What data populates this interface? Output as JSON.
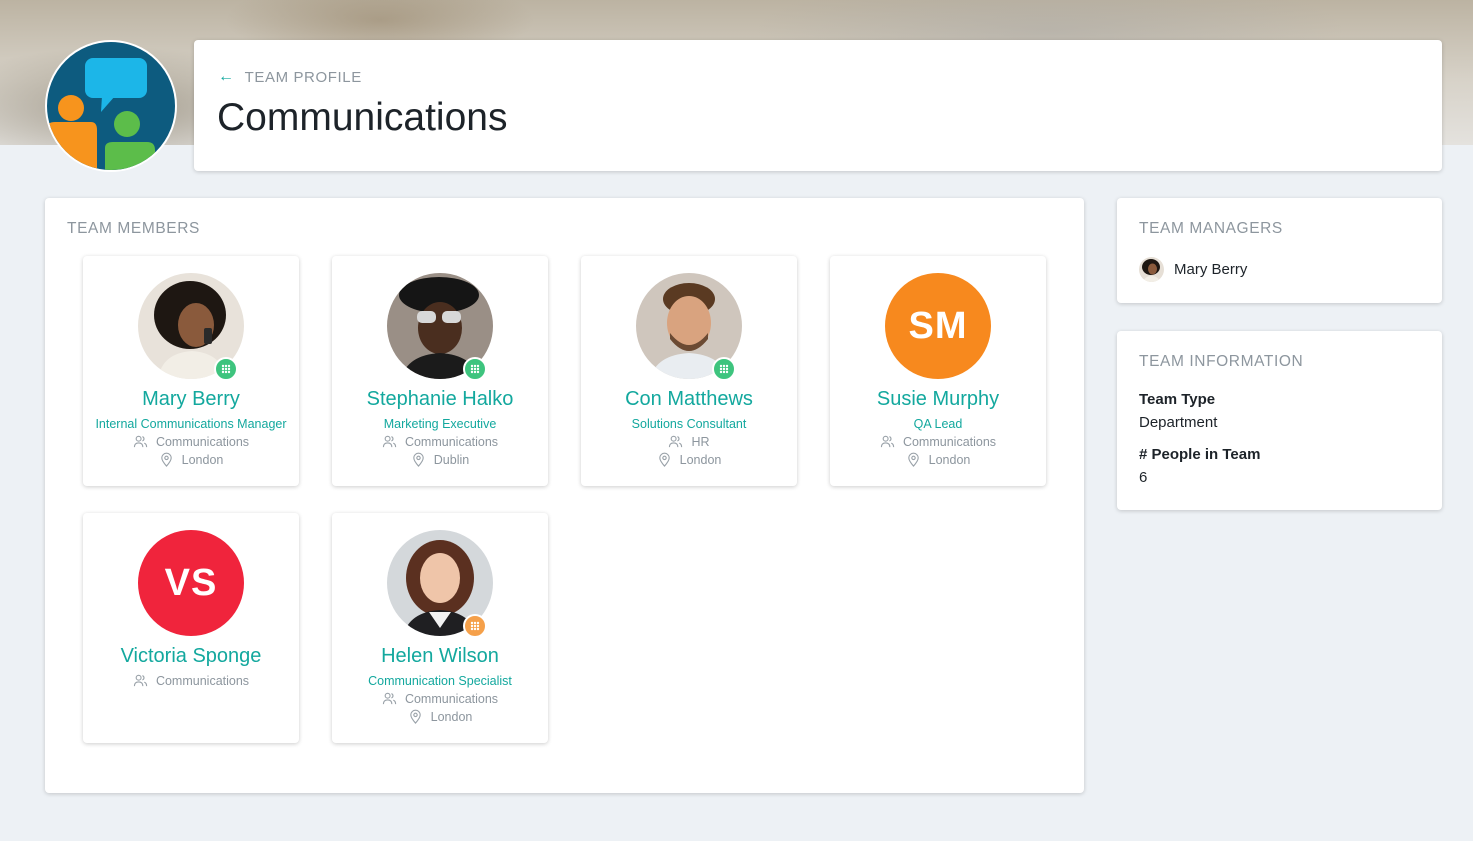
{
  "header": {
    "back_label": "TEAM PROFILE",
    "title": "Communications"
  },
  "members_section": {
    "title": "TEAM MEMBERS",
    "members": [
      {
        "name": "Mary Berry",
        "role": "Internal Communications Manager",
        "department": "Communications",
        "location": "London",
        "avatar": "photo",
        "status": "green"
      },
      {
        "name": "Stephanie Halko",
        "role": "Marketing Executive",
        "department": "Communications",
        "location": "Dublin",
        "avatar": "photo",
        "status": "green"
      },
      {
        "name": "Con Matthews",
        "role": "Solutions Consultant",
        "department": "HR",
        "location": "London",
        "avatar": "photo",
        "status": "green"
      },
      {
        "name": "Susie Murphy",
        "role": "QA Lead",
        "department": "Communications",
        "location": "London",
        "avatar": "initials",
        "initials": "SM",
        "avatar_color": "#f7891e"
      },
      {
        "name": "Victoria Sponge",
        "role": "",
        "department": "Communications",
        "location": "",
        "avatar": "initials",
        "initials": "VS",
        "avatar_color": "#f0243c"
      },
      {
        "name": "Helen Wilson",
        "role": "Communication Specialist",
        "department": "Communications",
        "location": "London",
        "avatar": "photo",
        "status": "orange"
      }
    ]
  },
  "managers": {
    "title": "TEAM MANAGERS",
    "items": [
      {
        "name": "Mary Berry"
      }
    ]
  },
  "team_info": {
    "title": "TEAM INFORMATION",
    "team_type_label": "Team Type",
    "team_type_value": "Department",
    "people_label": "# People in Team",
    "people_value": "6"
  },
  "colors": {
    "accent": "#13a89e",
    "status_green": "#3ec47e",
    "status_orange": "#f5a04a",
    "muted": "#8d969e"
  }
}
